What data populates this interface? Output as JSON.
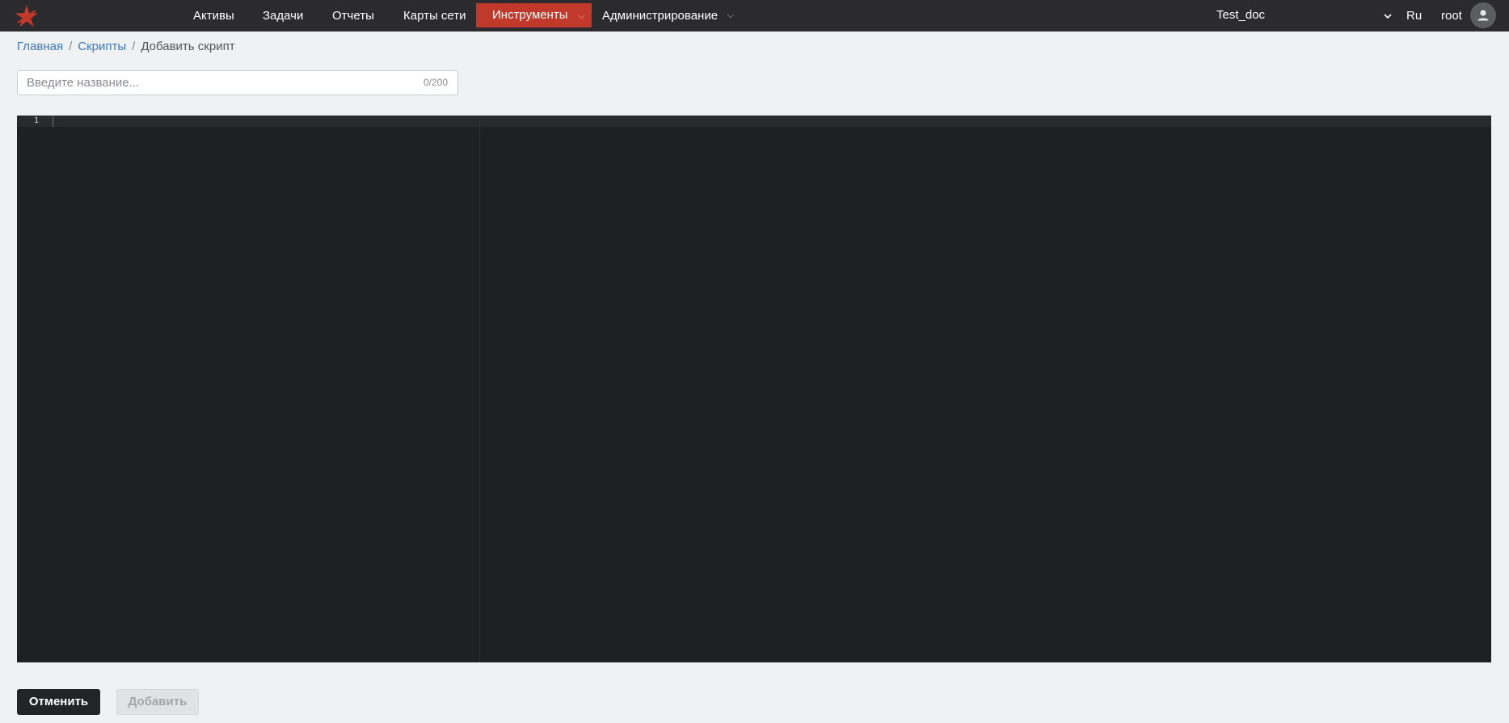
{
  "header": {
    "nav": [
      {
        "label": "Активы",
        "active": false,
        "has_dropdown": false
      },
      {
        "label": "Задачи",
        "active": false,
        "has_dropdown": false
      },
      {
        "label": "Отчеты",
        "active": false,
        "has_dropdown": false
      },
      {
        "label": "Карты сети",
        "active": false,
        "has_dropdown": false
      },
      {
        "label": "Инструменты",
        "active": true,
        "has_dropdown": true
      },
      {
        "label": "Администрирование",
        "active": false,
        "has_dropdown": true
      }
    ],
    "organization": "Test_doc",
    "language": "Ru",
    "username": "root",
    "colors": {
      "topbar_bg": "#2b2b2d",
      "active_tab": "#c0392b",
      "link": "#3b78c3"
    }
  },
  "breadcrumb": {
    "home": "Главная",
    "scripts": "Скрипты",
    "current": "Добавить скрипт"
  },
  "form": {
    "name_placeholder": "Введите название...",
    "name_value": "",
    "name_counter": "0/200"
  },
  "editor": {
    "line_numbers": [
      "1"
    ],
    "content": ""
  },
  "actions": {
    "cancel_label": "Отменить",
    "add_label": "Добавить",
    "add_disabled": true
  },
  "icons": {
    "logo": "red-star-icon",
    "org_dropdown": "chevron-down-icon",
    "nav_dropdown": "caret-down-icon",
    "avatar": "user-avatar-icon"
  }
}
